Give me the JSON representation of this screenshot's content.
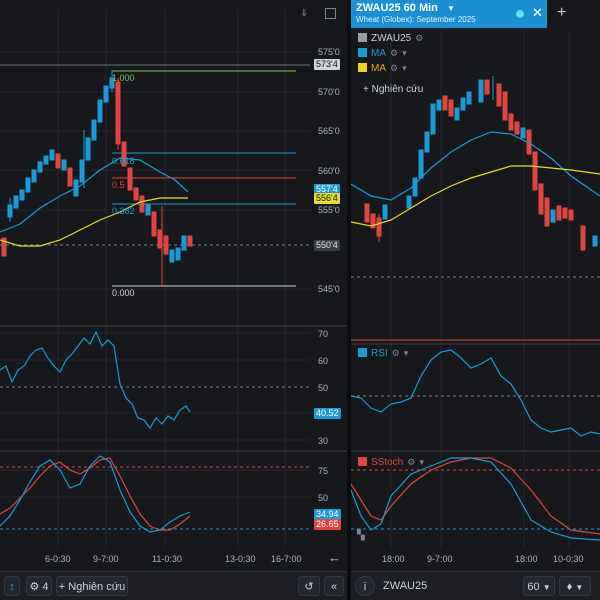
{
  "left_chart": {
    "price_axis": [
      "575'0",
      "570'0",
      "565'0",
      "560'0",
      "555'0",
      "550'0",
      "545'0"
    ],
    "price_tags": {
      "top": "573'4",
      "ma1": "557'4",
      "ma2": "556'4",
      "last": "550'4"
    },
    "fib_labels": [
      "1.000",
      "0.618",
      "0.5",
      "0.382",
      "0.000"
    ],
    "rsi_axis": [
      "70",
      "60",
      "50",
      "40",
      "30"
    ],
    "rsi_tag": "40.52",
    "stoch_axis": [
      "75",
      "50",
      "25"
    ],
    "stoch_tags": [
      "34.94",
      "26.65"
    ],
    "x_axis": [
      "6-0:30",
      "9-7:00",
      "11-0:30",
      "13-0:30",
      "16-7:00"
    ],
    "toolbar": {
      "count": "4",
      "research": "Nghiên cứu"
    }
  },
  "right_chart": {
    "symbol_title": "ZWAU25 60 Min",
    "subtitle": "Wheat (Globex): September 2025",
    "legend": [
      {
        "label": "ZWAU25",
        "color": "#9a9da3"
      },
      {
        "label": "MA",
        "color": "#1a9bd7"
      },
      {
        "label": "MA",
        "color": "#f0d41c"
      }
    ],
    "research": "Nghiên cứu",
    "rsi_label": "RSI",
    "stoch_label": "SStoch",
    "x_axis": [
      "18:00",
      "9-7:00",
      "18:00",
      "10-0:30"
    ],
    "toolbar": {
      "symbol": "ZWAU25",
      "interval": "60"
    }
  },
  "colors": {
    "up": "#1a9bd7",
    "down": "#e0463f",
    "ma_blue": "#1a9bd7",
    "ma_yellow": "#e8dc2c",
    "fib_green": "#7cc24a",
    "fib_red": "#e0463f"
  }
}
